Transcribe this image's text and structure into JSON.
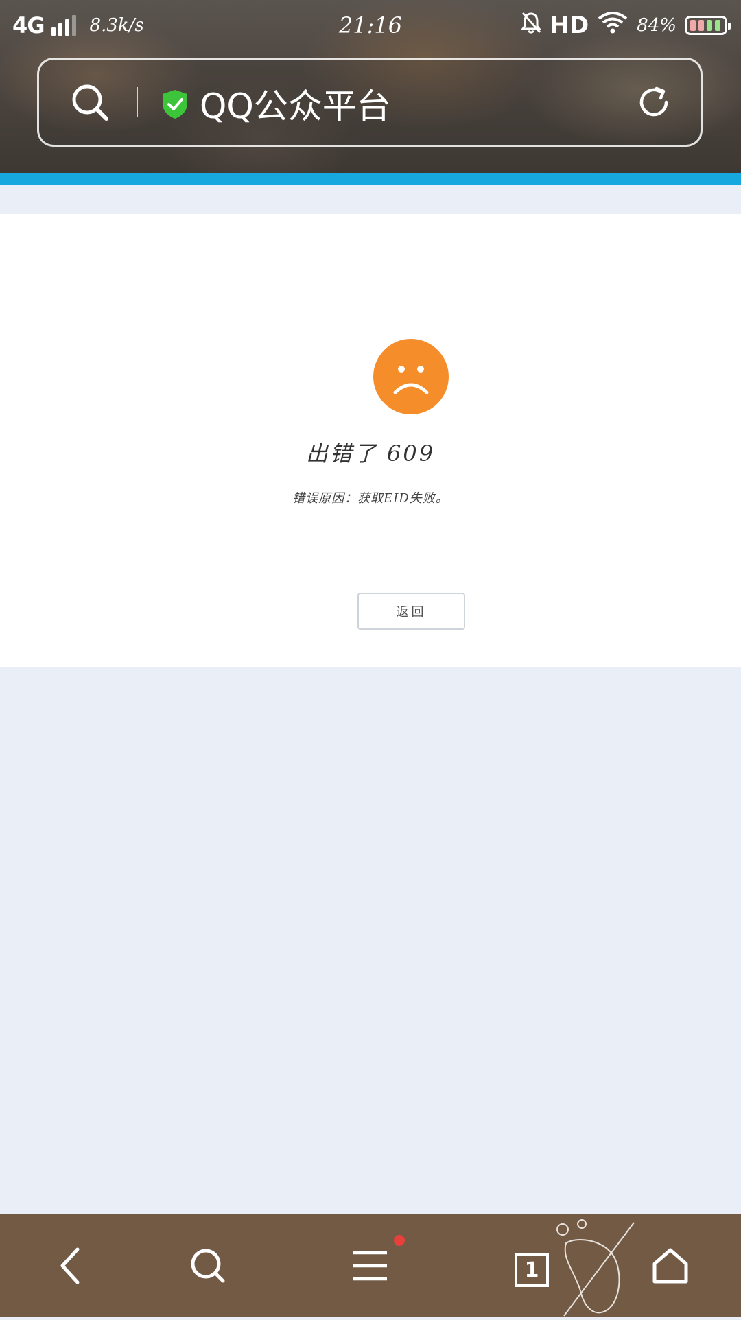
{
  "status_bar": {
    "network": "4G",
    "speed": "8.3k/s",
    "time": "21:16",
    "hd": "HD",
    "battery_percent": "84%"
  },
  "address_bar": {
    "title": "QQ公众平台",
    "secure_icon": "shield-check-icon"
  },
  "page": {
    "error_title": "出错了 609",
    "error_reason": "错误原因：获取EID失败。",
    "back_button": "返回"
  },
  "bottom_toolbar": {
    "tabs_count": "1",
    "icons": [
      "back-arrow-icon",
      "search-icon",
      "menu-icon",
      "tabs-icon",
      "home-icon"
    ]
  },
  "colors": {
    "progress": "#17a8e0",
    "error_face": "#f58d2b",
    "toolbar": "#735a45",
    "page_bg": "#eaeef7"
  }
}
